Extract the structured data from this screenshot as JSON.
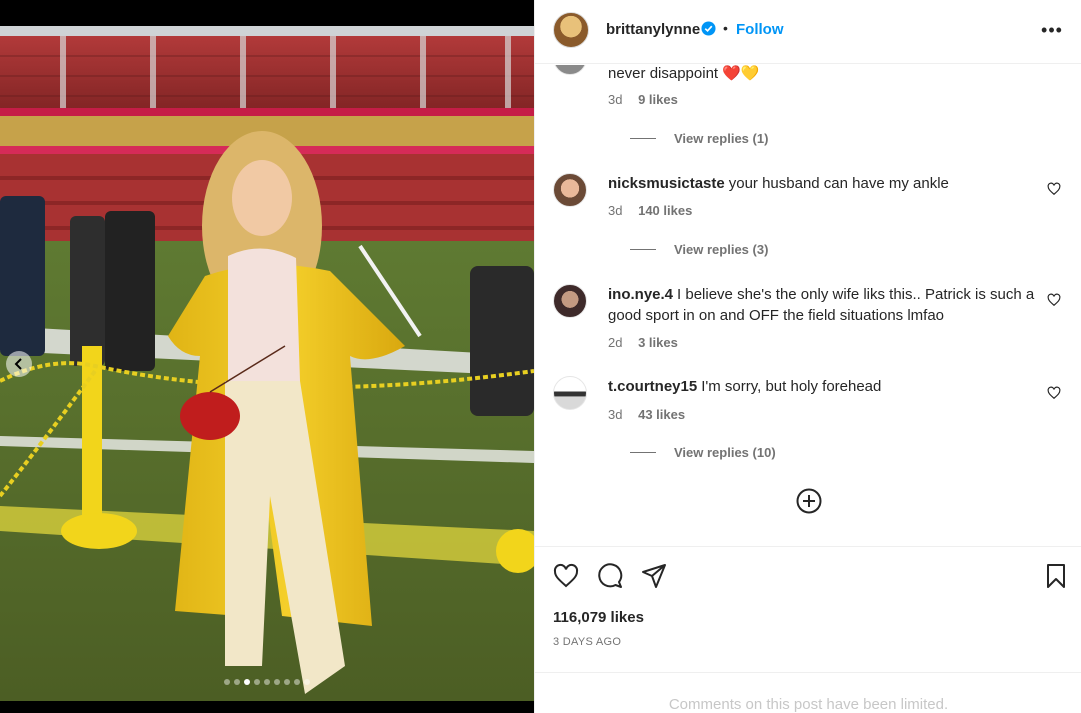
{
  "post": {
    "username": "brittanylynne",
    "separator": "•",
    "follow_label": "Follow",
    "more_label": "•••",
    "likes": "116,079 likes",
    "time": "3 DAYS AGO",
    "limited_notice": "Comments on this post have been limited.",
    "carousel": {
      "total": 9,
      "active_index": 2
    }
  },
  "comments": [
    {
      "user": "",
      "text": "never disappoint",
      "emoji": "❤️💛",
      "time": "3d",
      "likes": "9 likes",
      "replies": "View replies (1)"
    },
    {
      "user": "nicksmusictaste",
      "text": "your husband can have my ankle",
      "time": "3d",
      "likes": "140 likes",
      "replies": "View replies (3)"
    },
    {
      "user": "ino.nye.4",
      "text": "I believe she's the only wife liks this.. Patrick is such a good sport in on and OFF the field situations lmfao",
      "time": "2d",
      "likes": "3 likes",
      "replies": ""
    },
    {
      "user": "t.courtney15",
      "text": "I'm sorry, but holy forehead",
      "time": "3d",
      "likes": "43 likes",
      "replies": "View replies (10)"
    }
  ],
  "icons": [
    "verified-badge-icon",
    "more-options-icon",
    "heart-icon",
    "comment-icon",
    "share-icon",
    "bookmark-icon",
    "plus-circle-icon",
    "chevron-left-icon"
  ],
  "colors": {
    "accent": "#0095f6",
    "text": "#262626",
    "muted": "#737373",
    "limited": "#c7c7c7"
  }
}
